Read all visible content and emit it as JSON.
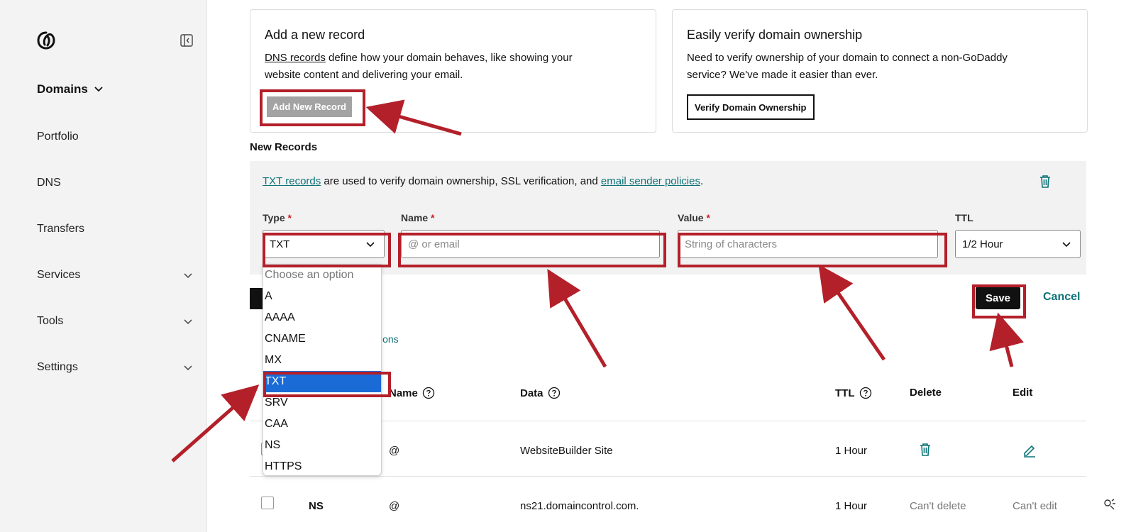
{
  "sidebar": {
    "domains_label": "Domains",
    "items": [
      {
        "label": "Portfolio"
      },
      {
        "label": "DNS"
      },
      {
        "label": "Transfers"
      },
      {
        "label": "Services"
      },
      {
        "label": "Tools"
      },
      {
        "label": "Settings"
      }
    ]
  },
  "add_card": {
    "title": "Add a new record",
    "link_text": "DNS records",
    "desc_rest": " define how your domain behaves, like showing your",
    "desc_line2": "website content and delivering your email.",
    "button": "Add New Record"
  },
  "verify_card": {
    "title": "Easily verify domain ownership",
    "desc_line1": "Need to verify ownership of your domain to connect a non-GoDaddy",
    "desc_line2": "service? We've made it easier than ever.",
    "button": "Verify Domain Ownership"
  },
  "new_records": {
    "title": "New Records",
    "info_link1": "TXT records",
    "info_mid": " are used to verify domain ownership, SSL verification, and ",
    "info_link2": "email sender policies",
    "info_end": ".",
    "type_label": "Type",
    "name_label": "Name",
    "value_label": "Value",
    "ttl_label": "TTL",
    "required_mark": "*",
    "type_value": "TXT",
    "name_placeholder": "@ or email",
    "value_placeholder": "String of characters",
    "ttl_value": "1/2 Hour"
  },
  "type_dropdown": {
    "options": [
      "Choose an option",
      "A",
      "AAAA",
      "CNAME",
      "MX",
      "TXT",
      "SRV",
      "CAA",
      "NS",
      "HTTPS"
    ],
    "selected": "TXT"
  },
  "actions": {
    "save": "Save",
    "cancel": "Cancel",
    "partial_link": "ions"
  },
  "table": {
    "headers": {
      "name": "Name",
      "data": "Data",
      "ttl": "TTL",
      "delete": "Delete",
      "edit": "Edit"
    },
    "rows": [
      {
        "type": "",
        "name": "@",
        "data": "WebsiteBuilder Site",
        "ttl": "1 Hour",
        "delete": "",
        "edit": ""
      },
      {
        "type": "NS",
        "name": "@",
        "data": "ns21.domaincontrol.com.",
        "ttl": "1 Hour",
        "delete": "Can't delete",
        "edit": "Can't edit"
      }
    ]
  },
  "colors": {
    "highlight": "#b3202a",
    "link": "#0d7377",
    "selected": "#1a6bd6"
  }
}
